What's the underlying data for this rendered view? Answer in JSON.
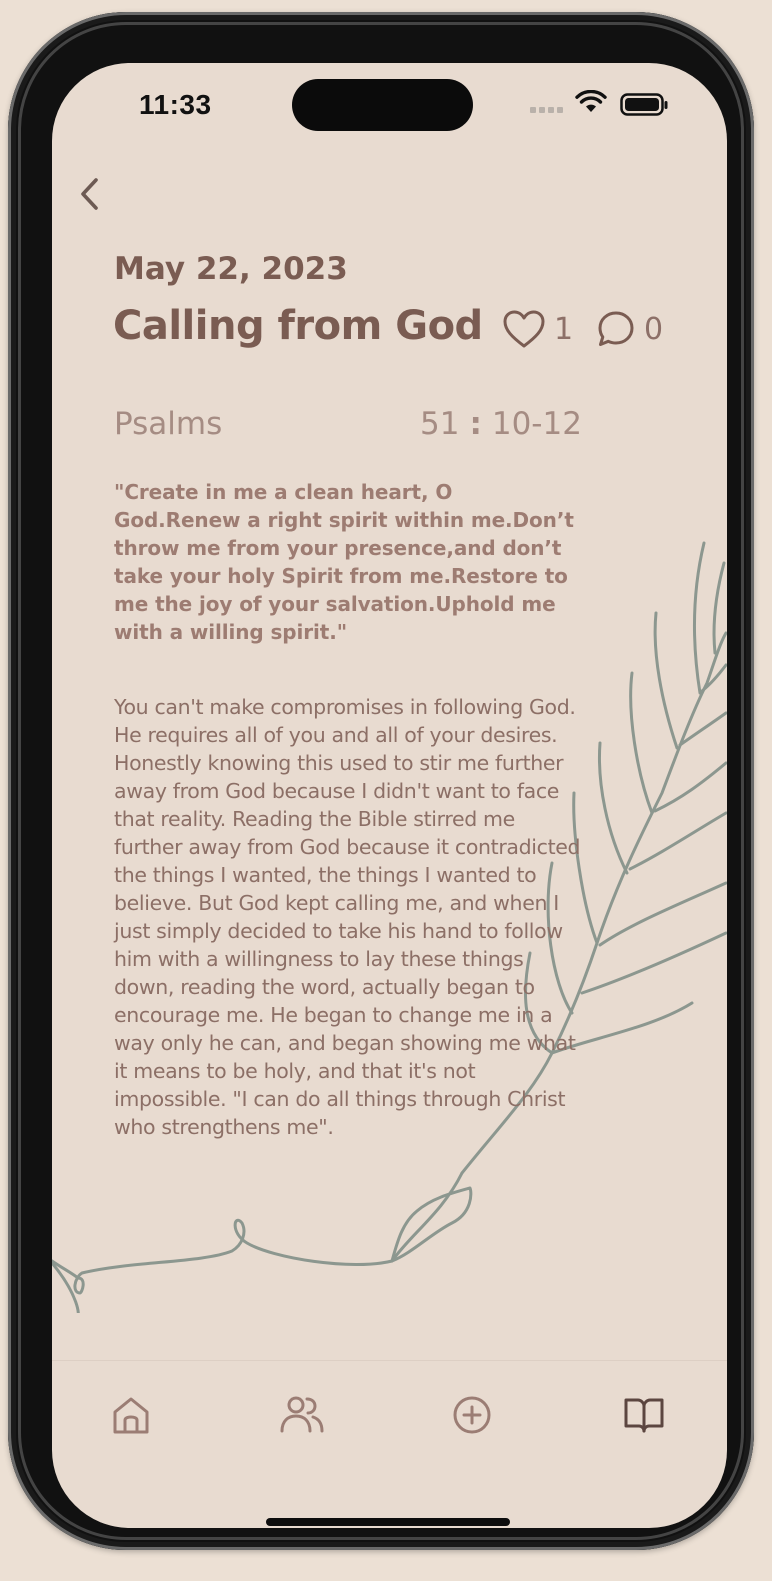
{
  "status_bar": {
    "time": "11:33",
    "icons": [
      "signal-icon",
      "wifi-icon",
      "battery-icon"
    ]
  },
  "header": {
    "back_icon": "chevron-left-icon"
  },
  "devotional": {
    "date": "May 22, 2023",
    "title": "Calling from God",
    "likes": "1",
    "comments": "0",
    "book": "Psalms",
    "chapter": "51",
    "verses": "10-12",
    "verse_text": "\"Create in me a clean heart, O God.Renew a right spirit within me.Don’t throw me from your presence,and don’t take your holy Spirit from me.Restore to me the joy of your salvation.Uphold me with a willing spirit.\"",
    "reflection": "You can't make compromises in following God. He requires all of you and all of your desires. Honestly knowing this used to stir me further away from God because I didn't want to face that reality. Reading the Bible stirred me further away from God because it contradicted the things I wanted, the things I wanted to believe. But God kept calling me, and when I just simply decided to take his hand to follow him with a willingness to lay these things down, reading the word, actually began to encourage me. He began to change me in a way only he can, and began showing me what it means to be holy, and that it's not impossible. \"I can do all things through Christ who strengthens me\"."
  },
  "bottom_nav": {
    "items": [
      "home-icon",
      "people-icon",
      "add-circle-icon",
      "book-open-icon"
    ]
  },
  "colors": {
    "background": "#e8dbd0",
    "text_primary": "#7a5c52",
    "text_secondary": "#a58c83",
    "illustration": "#8c978f"
  }
}
